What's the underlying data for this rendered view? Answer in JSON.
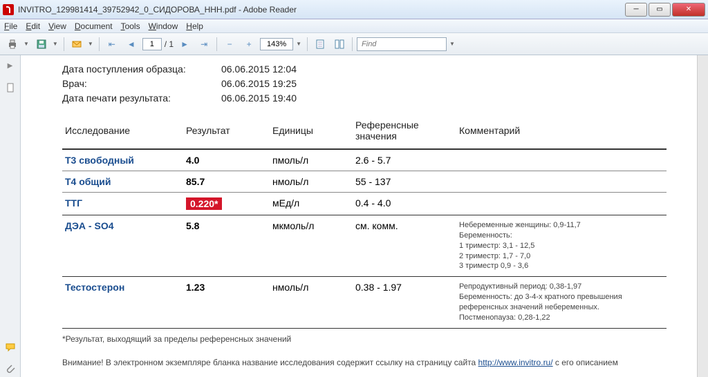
{
  "window": {
    "title": "INVITRO_129981414_39752942_0_СИДОРОВА_ННН.pdf - Adobe Reader"
  },
  "menu": {
    "file": "File",
    "edit": "Edit",
    "view": "View",
    "document": "Document",
    "tools": "Tools",
    "window": "Window",
    "help": "Help"
  },
  "toolbar": {
    "page_current": "1",
    "page_total": "/ 1",
    "zoom": "143%",
    "find_placeholder": "Find"
  },
  "doc": {
    "meta": {
      "sample_date_label": "Дата поступления образца:",
      "sample_date": "06.06.2015 12:04",
      "doctor_label": "Врач:",
      "doctor_date": "06.06.2015 19:25",
      "print_label": "Дата печати результата:",
      "print_date": "06.06.2015 19:40"
    },
    "headers": {
      "test": "Исследование",
      "result": "Результат",
      "units": "Единицы",
      "ref": "Референсные значения",
      "comment": "Комментарий"
    },
    "rows": [
      {
        "test": "Т3 свободный",
        "result": "4.0",
        "units": "пмоль/л",
        "ref": "2.6 - 5.7",
        "comment": "",
        "alert": false
      },
      {
        "test": "Т4 общий",
        "result": "85.7",
        "units": "нмоль/л",
        "ref": "55 - 137",
        "comment": "",
        "alert": false
      },
      {
        "test": "ТТГ",
        "result": "0.220*",
        "units": "мЕд/л",
        "ref": "0.4 - 4.0",
        "comment": "",
        "alert": true
      },
      {
        "test": "ДЭА - SO4",
        "result": "5.8",
        "units": "мкмоль/л",
        "ref": "см. комм.",
        "comment": "Небеременные женщины: 0,9-11,7\nБеременность:\n1 триместр: 3,1 - 12,5\n2 триместр: 1,7 - 7,0\n3 триместр 0,9 - 3,6",
        "alert": false
      },
      {
        "test": "Тестостерон",
        "result": "1.23",
        "units": "нмоль/л",
        "ref": "0.38 - 1.97",
        "comment": "Репродуктивный период: 0,38-1,97\nБеременность: до 3-4-х кратного превышения референсных значений небеременных.\nПостменопауза: 0,28-1,22",
        "alert": false
      }
    ],
    "footnote": "*Результат, выходящий за пределы референсных значений",
    "notice_pre": "Внимание! В электронном экземпляре бланка название исследования содержит ссылку на страницу сайта ",
    "notice_link": "http://www.invitro.ru/",
    "notice_post": " с его описанием"
  }
}
